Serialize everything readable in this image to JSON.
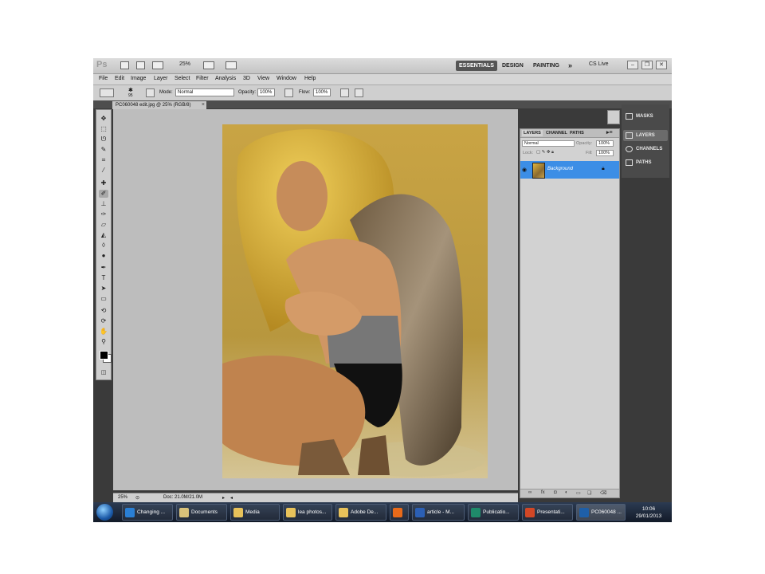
{
  "app": {
    "logo": "Ps",
    "zoom_display": "25%",
    "workspaces": [
      "ESSENTIALS",
      "DESIGN",
      "PAINTING"
    ],
    "more": "»",
    "cslive": "CS Live"
  },
  "menu": [
    "File",
    "Edit",
    "Image",
    "Layer",
    "Select",
    "Filter",
    "Analysis",
    "3D",
    "View",
    "Window",
    "Help"
  ],
  "options": {
    "brush_size": "95",
    "mode_label": "Mode:",
    "mode_value": "Normal",
    "opacity_label": "Opacity:",
    "opacity_value": "100%",
    "flow_label": "Flow:",
    "flow_value": "100%"
  },
  "document": {
    "tab_title": "PC060048 edit.jpg @ 25% (RGB/8)",
    "close": "×"
  },
  "status": {
    "zoom": "25%",
    "doc_info": "Doc: 21.0M/21.0M"
  },
  "layers_panel": {
    "tabs": [
      "LAYERS",
      "CHANNEL",
      "PATHS"
    ],
    "blend_mode": "Normal",
    "opacity_label": "Opacity:",
    "opacity_value": "100%",
    "lock_label": "Lock:",
    "fill_label": "Fill:",
    "fill_value": "100%",
    "layer_name": "Background"
  },
  "side_panel": {
    "items": [
      "MASKS",
      "LAYERS",
      "CHANNELS",
      "PATHS"
    ]
  },
  "taskbar": {
    "items": [
      {
        "label": "Changing ...",
        "icon_color": "#2a7fd4"
      },
      {
        "label": "Documents",
        "icon_color": "#d9c27a"
      },
      {
        "label": "Media",
        "icon_color": "#e8c25a"
      },
      {
        "label": "lea photos...",
        "icon_color": "#e8c25a"
      },
      {
        "label": "Adobe De...",
        "icon_color": "#e8c25a"
      },
      {
        "label": "",
        "icon_color": "#e86a1a"
      },
      {
        "label": "article - M...",
        "icon_color": "#2b5fb4"
      },
      {
        "label": "Publicatio...",
        "icon_color": "#1f8a6a"
      },
      {
        "label": "Presentati...",
        "icon_color": "#d24726"
      },
      {
        "label": "PC060048 ...",
        "icon_color": "#1e5fa8"
      }
    ],
    "time": "10:06",
    "date": "29/01/2013"
  },
  "colors": {
    "layer_selected": "#3c8ee6",
    "canvas_bg": "#bdbdbd",
    "ui_dark": "#3a3a3a"
  }
}
